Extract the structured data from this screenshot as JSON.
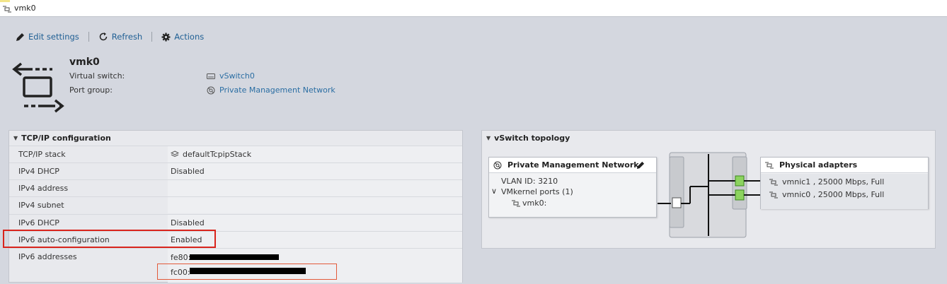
{
  "window": {
    "title": "vmk0"
  },
  "toolbar": {
    "edit_label": "Edit settings",
    "refresh_label": "Refresh",
    "actions_label": "Actions"
  },
  "header": {
    "title": "vmk0",
    "virtual_switch_label": "Virtual switch:",
    "virtual_switch_value": "vSwitch0",
    "port_group_label": "Port group:",
    "port_group_value": "Private Management Network"
  },
  "tcpip": {
    "title": "TCP/IP configuration",
    "rows": [
      {
        "label": "TCP/IP stack",
        "value": "defaultTcpipStack"
      },
      {
        "label": "IPv4 DHCP",
        "value": "Disabled"
      },
      {
        "label": "IPv4 address",
        "value": ""
      },
      {
        "label": "IPv4 subnet",
        "value": ""
      },
      {
        "label": "IPv6 DHCP",
        "value": "Disabled"
      },
      {
        "label": "IPv6 auto-configuration",
        "value": "Enabled"
      },
      {
        "label": "IPv6 addresses",
        "value": "fe80:"
      }
    ],
    "ipv6_second": "fc00:"
  },
  "topology": {
    "title": "vSwitch topology",
    "portgroup": {
      "name": "Private Management Network",
      "vlan": "VLAN ID: 3210",
      "vmkernel_ports": "VMkernel ports (1)",
      "vmk": "vmk0:"
    },
    "adapters": {
      "title": "Physical adapters",
      "items": [
        "vmnic1 , 25000 Mbps, Full",
        "vmnic0 , 25000 Mbps, Full"
      ]
    }
  },
  "colors": {
    "link": "#2b6ea3",
    "highlight": "#d9241c",
    "port_green": "#8cd35f"
  }
}
